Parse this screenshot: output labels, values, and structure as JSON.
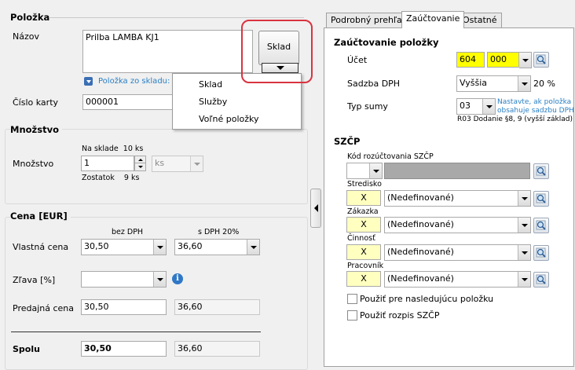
{
  "polozka": {
    "title": "Položka",
    "nazov_label": "Názov",
    "nazov_value": "Prilba LAMBA KJ1",
    "sklad_button": "Sklad",
    "zo_skladu_link": "Položka zo skladu: Sklad",
    "cislo_karty_label": "Číslo karty",
    "cislo_karty_value": "000001"
  },
  "dropdown_menu": {
    "items": [
      "Sklad",
      "Služby",
      "Voľné položky"
    ]
  },
  "mnozstvo": {
    "title": "Množstvo",
    "na_sklade": "Na sklade  10 ks",
    "label": "Množstvo",
    "value": "1",
    "unit": "ks",
    "zostatok": "Zostatok    9 ks"
  },
  "cena": {
    "title": "Cena [EUR]",
    "col_bez_dph": "bez DPH",
    "col_s_dph": "s DPH 20%",
    "vlastna_label": "Vlastná cena",
    "vlastna_bez": "30,50",
    "vlastna_s": "36,60",
    "zlava_label": "Zľava [%]",
    "zlava_value": "",
    "predajna_label": "Predajná cena",
    "predajna_bez": "30,50",
    "predajna_s": "36,60",
    "spolu_label": "Spolu",
    "spolu_bez": "30,50",
    "spolu_s": "36,60"
  },
  "tabs": [
    "Podrobný prehľad",
    "Zaúčtovanie",
    "Ostatné"
  ],
  "zauctovanie": {
    "title": "Zaúčtovanie položky",
    "ucet_label": "Účet",
    "ucet_a": "604",
    "ucet_b": "000",
    "sadzba_label": "Sadzba DPH",
    "sadzba_value": "Vyššia",
    "sadzba_pct": "20 %",
    "typ_label": "Typ sumy",
    "typ_value": "03",
    "typ_note_1": "Nastavte, ak položka",
    "typ_note_2": "obsahuje sadzbu DPH",
    "typ_desc": "R03 Dodanie §8, 9 (vyšší základ)"
  },
  "szcp": {
    "title": "SZČP",
    "kod_label": "Kód rozúčtovania SZČP",
    "rows": [
      {
        "label": "Stredisko",
        "code": "X",
        "value": "(Nedefinované)"
      },
      {
        "label": "Zákazka",
        "code": "X",
        "value": "(Nedefinované)"
      },
      {
        "label": "Činnosť",
        "code": "X",
        "value": "(Nedefinované)"
      },
      {
        "label": "Pracovník",
        "code": "X",
        "value": "(Nedefinované)"
      }
    ],
    "chk1": "Použiť pre nasledujúcu položku",
    "chk2": "Použiť rozpis SZČP"
  },
  "colors": {
    "highlight_yellow": "#ffff00",
    "annotation_red": "#d9333f",
    "link_blue": "#2a7fc4"
  }
}
